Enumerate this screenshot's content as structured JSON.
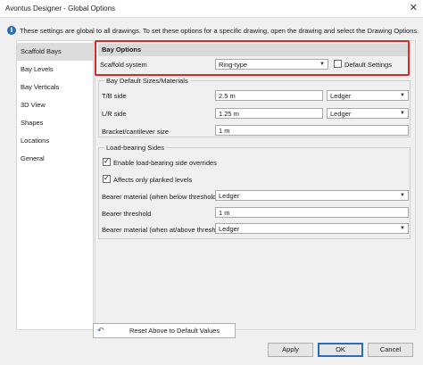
{
  "window": {
    "title": "Avontus Designer - Global Options",
    "close": "✕"
  },
  "info": {
    "icon": "info-icon",
    "text": "These settings are global to all drawings. To set these options for a specific drawing, open the drawing and select the Drawing Options."
  },
  "sidebar": {
    "items": [
      {
        "label": "Scaffold Bays",
        "active": true
      },
      {
        "label": "Bay Levels"
      },
      {
        "label": "Bay Verticals"
      },
      {
        "label": "3D View"
      },
      {
        "label": "Shapes"
      },
      {
        "label": "Locations"
      },
      {
        "label": "General"
      }
    ]
  },
  "bay_options": {
    "heading": "Bay Options",
    "scaffold_system_label": "Scaffold system",
    "scaffold_system_value": "Ring-type",
    "default_settings_label": "Default Settings",
    "default_settings_checked": false
  },
  "bay_default_sizes": {
    "title": "Bay Default Sizes/Materials",
    "tb_label": "T/B side",
    "tb_value": "2.5 m",
    "tb_material": "Ledger",
    "lr_label": "L/R side",
    "lr_value": "1.25 m",
    "lr_material": "Ledger",
    "bracket_label": "Bracket/cantilever size",
    "bracket_value": "1 m"
  },
  "load_bearing": {
    "title": "Load-bearing Sides",
    "enable_label": "Enable load-bearing side overrides",
    "enable_checked": true,
    "planked_label": "Affects only planked levels",
    "planked_checked": true,
    "below_label": "Bearer material (when below threshold)",
    "below_value": "Ledger",
    "threshold_label": "Bearer threshold",
    "threshold_value": "1 m",
    "above_label": "Bearer material (when at/above threshold)",
    "above_value": "Ledger"
  },
  "footer": {
    "reset_label": "Reset Above to Default Values",
    "apply_label": "Apply",
    "ok_label": "OK",
    "cancel_label": "Cancel"
  },
  "colors": {
    "accent": "#2b6cb8",
    "highlight": "#d62b2b"
  }
}
